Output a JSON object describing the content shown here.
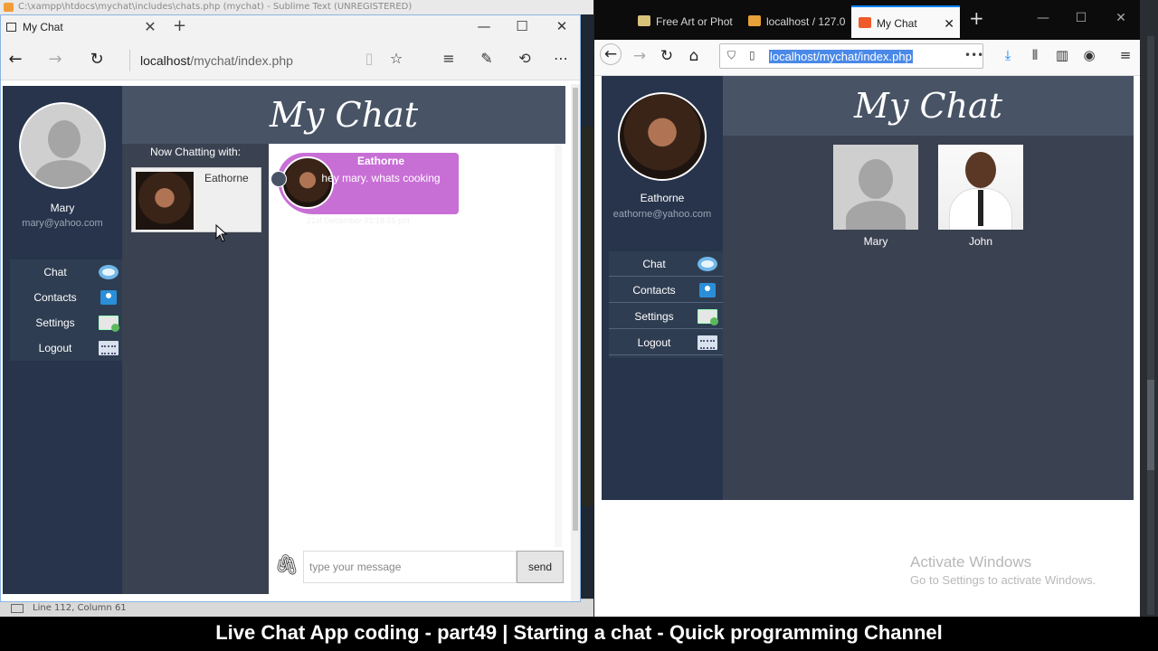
{
  "sublime": {
    "title": "C:\\xampp\\htdocs\\mychat\\includes\\chats.php (mychat) - Sublime Text (UNREGISTERED)",
    "status": "Line 112, Column 61"
  },
  "edge": {
    "tab_title": "My Chat",
    "url_host": "localhost",
    "url_path": "/mychat/index.php"
  },
  "firefox": {
    "tabs": [
      {
        "label": "Free Art or Phot"
      },
      {
        "label": "localhost / 127.0"
      },
      {
        "label": "My Chat"
      }
    ],
    "url": "localhost/mychat/index.php"
  },
  "app_title": "My Chat",
  "menu": {
    "chat": "Chat",
    "contacts": "Contacts",
    "settings": "Settings",
    "logout": "Logout"
  },
  "edge_app": {
    "user_name": "Mary",
    "user_email": "mary@yahoo.com",
    "now_chatting_label": "Now Chatting with:",
    "chatting_with": "Eathorne",
    "message": {
      "sender": "Eathorne",
      "text": "hey mary. whats cooking",
      "time": "21st December 01:18:55 pm"
    },
    "input_placeholder": "type your message",
    "send_label": "send"
  },
  "ff_app": {
    "user_name": "Eathorne",
    "user_email": "eathorne@yahoo.com",
    "contacts": [
      {
        "name": "Mary"
      },
      {
        "name": "John"
      }
    ]
  },
  "watermark": {
    "line1": "Activate Windows",
    "line2": "Go to Settings to activate Windows."
  },
  "caption": "Live Chat App coding - part49 | Starting a chat - Quick programming Channel",
  "colors": {
    "sidebar": "#27344b",
    "header": "#485466",
    "bubble": "#c86fd6",
    "panel": "#3a4150"
  }
}
